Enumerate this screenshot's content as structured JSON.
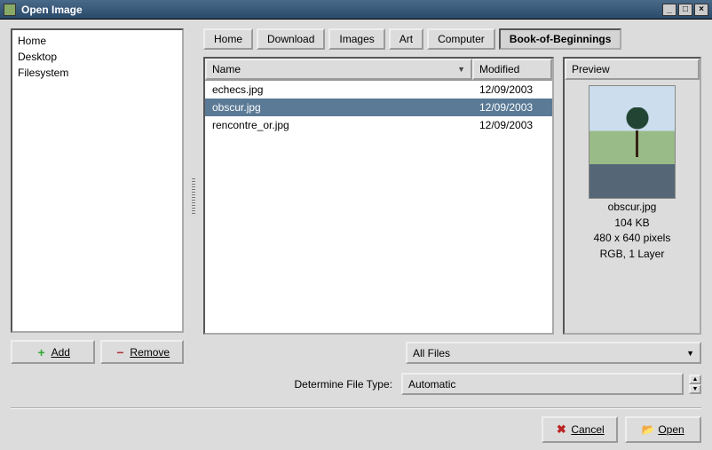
{
  "window": {
    "title": "Open Image"
  },
  "places": {
    "items": [
      "Home",
      "Desktop",
      "Filesystem"
    ]
  },
  "buttons": {
    "add": "Add",
    "remove": "Remove",
    "cancel": "Cancel",
    "open": "Open"
  },
  "breadcrumbs": [
    {
      "label": "Home",
      "active": false
    },
    {
      "label": "Download",
      "active": false
    },
    {
      "label": "Images",
      "active": false
    },
    {
      "label": "Art",
      "active": false
    },
    {
      "label": "Computer",
      "active": false
    },
    {
      "label": "Book-of-Beginnings",
      "active": true
    }
  ],
  "columns": {
    "name": "Name",
    "modified": "Modified"
  },
  "files": [
    {
      "name": "echecs.jpg",
      "modified": "12/09/2003",
      "selected": false
    },
    {
      "name": "obscur.jpg",
      "modified": "12/09/2003",
      "selected": true
    },
    {
      "name": "rencontre_or.jpg",
      "modified": "12/09/2003",
      "selected": false
    }
  ],
  "preview": {
    "header": "Preview",
    "filename": "obscur.jpg",
    "size": "104 KB",
    "dimensions": "480 x 640 pixels",
    "mode": "RGB, 1 Layer"
  },
  "filter": {
    "value": "All Files"
  },
  "filetype": {
    "label": "Determine File Type:",
    "value": "Automatic"
  }
}
